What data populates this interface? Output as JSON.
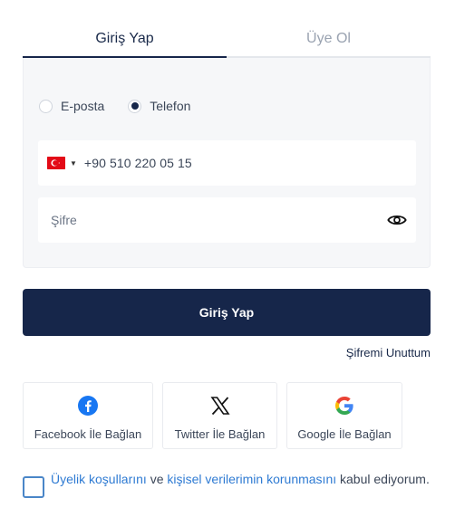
{
  "tabs": {
    "login": "Giriş Yap",
    "register": "Üye Ol"
  },
  "login_method": {
    "options": [
      "E-posta",
      "Telefon"
    ],
    "selected": "Telefon"
  },
  "phone": {
    "country": "TR",
    "value": "+90 510 220 05 15"
  },
  "password": {
    "placeholder": "Şifre"
  },
  "buttons": {
    "login": "Giriş Yap",
    "forgot": "Şifremi Unuttum"
  },
  "social": {
    "facebook": "Facebook İle Bağlan",
    "twitter": "Twitter İle Bağlan",
    "google": "Google İle Bağlan"
  },
  "terms": {
    "link1": "Üyelik koşullarını",
    "and": " ve ",
    "link2": "kişisel verilerimin korunmasını",
    "suffix": " kabul ediyorum."
  },
  "colors": {
    "primary": "#16264a",
    "link": "#2f7bd3",
    "facebook": "#1877f2"
  }
}
